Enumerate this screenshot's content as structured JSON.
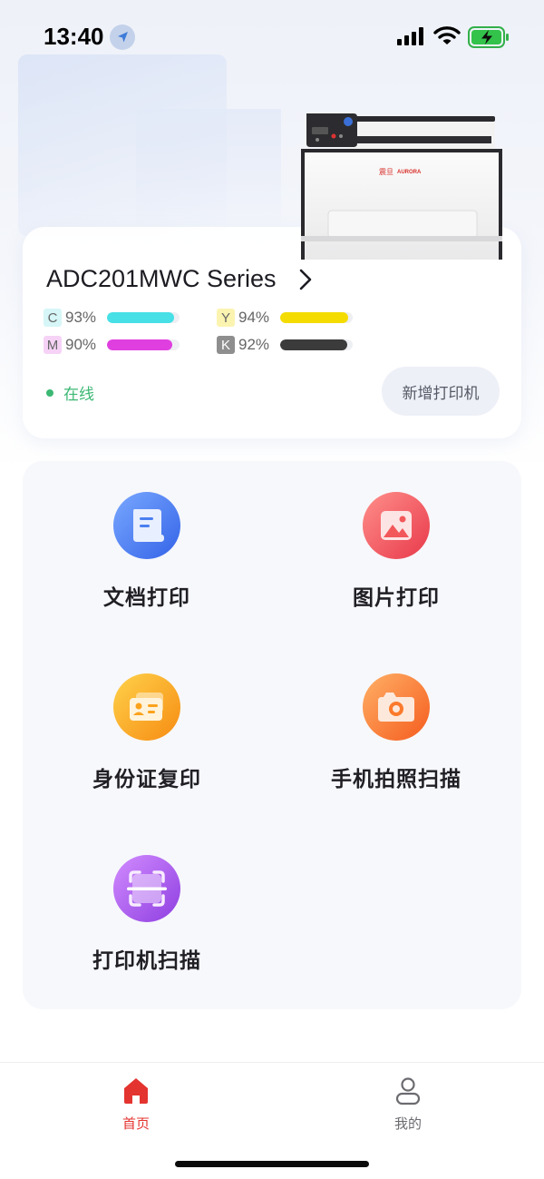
{
  "status_bar": {
    "time": "13:40",
    "icons": [
      "location-arrow-icon",
      "signal-icon",
      "wifi-icon",
      "battery-charging-icon"
    ]
  },
  "printer_card": {
    "name": "ADC201MWC Series",
    "brand_logo_text": "震旦 AURORA",
    "inks": [
      {
        "letter": "C",
        "percent": "93%",
        "level": 0.93,
        "color": "#46e0e6",
        "badge_bg": "#d6f6f7"
      },
      {
        "letter": "Y",
        "percent": "94%",
        "level": 0.94,
        "color": "#f4dc00",
        "badge_bg": "#fbf3b0"
      },
      {
        "letter": "M",
        "percent": "90%",
        "level": 0.9,
        "color": "#e03fe0",
        "badge_bg": "#f6d3f6"
      },
      {
        "letter": "K",
        "percent": "92%",
        "level": 0.92,
        "color": "#3b3b3b",
        "badge_bg": "#8e8e8e"
      }
    ],
    "status": "在线",
    "status_color": "#3bb873",
    "add_printer_label": "新增打印机"
  },
  "functions": [
    {
      "label": "文档打印",
      "icon": "document-icon",
      "color": "#4a7ff0"
    },
    {
      "label": "图片打印",
      "icon": "image-icon",
      "color": "#f2575a"
    },
    {
      "label": "身份证复印",
      "icon": "id-card-icon",
      "color": "#fba21b"
    },
    {
      "label": "手机拍照扫描",
      "icon": "camera-icon",
      "color": "#fb7a2b"
    },
    {
      "label": "打印机扫描",
      "icon": "scan-icon",
      "color": "#b256e8"
    }
  ],
  "tabbar": {
    "tabs": [
      {
        "label": "首页",
        "icon": "home-icon",
        "active": true,
        "color": "#e4342f"
      },
      {
        "label": "我的",
        "icon": "user-icon",
        "active": false,
        "color": "#6b6b70"
      }
    ]
  }
}
